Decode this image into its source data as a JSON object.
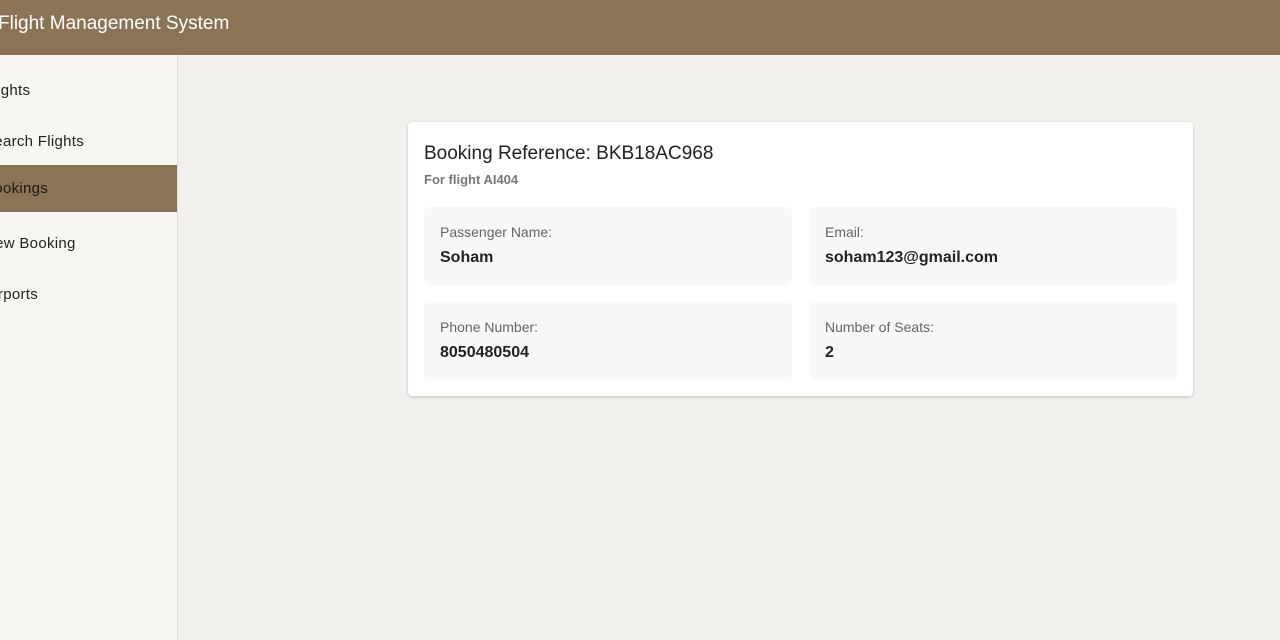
{
  "header": {
    "title": "Flight Management System"
  },
  "sidebar": {
    "items": [
      {
        "label": "Flights"
      },
      {
        "label": "Search Flights"
      },
      {
        "label": "Bookings",
        "active": true
      },
      {
        "label": "New Booking"
      },
      {
        "label": "Airports"
      }
    ]
  },
  "booking": {
    "title": "Booking Reference: BKB18AC968",
    "subtitle": "For flight AI404",
    "fields": [
      {
        "label": "Passenger Name:",
        "value": "Soham"
      },
      {
        "label": "Email:",
        "value": "soham123@gmail.com"
      },
      {
        "label": "Phone Number:",
        "value": "8050480504"
      },
      {
        "label": "Number of Seats:",
        "value": "2"
      }
    ]
  },
  "colors": {
    "primary": "#8b7355",
    "background": "#f3f1ed"
  }
}
